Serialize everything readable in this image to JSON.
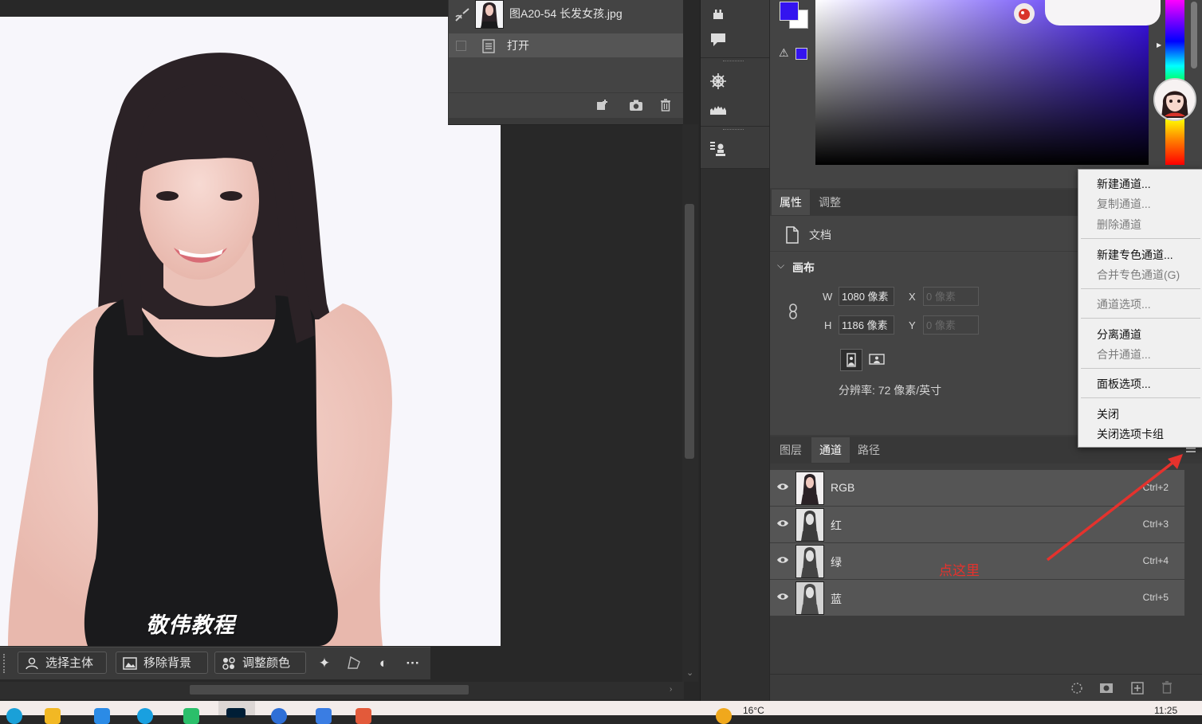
{
  "history": {
    "snapshot_label": "图A20-54 长发女孩.jpg",
    "step_label": "打开"
  },
  "context_bar": {
    "select_subject": "选择主体",
    "remove_background": "移除背景",
    "adjust_color": "调整颜色",
    "more": "···"
  },
  "canvas": {
    "watermark": "敬伟教程"
  },
  "properties": {
    "tabs": [
      "属性",
      "调整"
    ],
    "doc_label": "文档",
    "section_title": "画布",
    "w_label": "W",
    "h_label": "H",
    "x_label": "X",
    "y_label": "Y",
    "w_value": "1080 像素",
    "h_value": "1186 像素",
    "x_placeholder": "0 像素",
    "y_placeholder": "0 像素",
    "resolution": "分辨率: 72 像素/英寸"
  },
  "channels_panel": {
    "tabs": [
      "图层",
      "通道",
      "路径"
    ],
    "active_tab": "通道",
    "rows": [
      {
        "name": "RGB",
        "shortcut": "Ctrl+2"
      },
      {
        "name": "红",
        "shortcut": "Ctrl+3"
      },
      {
        "name": "绿",
        "shortcut": "Ctrl+4"
      },
      {
        "name": "蓝",
        "shortcut": "Ctrl+5"
      }
    ]
  },
  "menu": {
    "items": [
      {
        "label": "新建通道...",
        "enabled": true
      },
      {
        "label": "复制通道...",
        "enabled": false
      },
      {
        "label": "删除通道",
        "enabled": false
      },
      {
        "label": "新建专色通道...",
        "enabled": true
      },
      {
        "label": "合并专色通道(G)",
        "enabled": false
      },
      {
        "label": "通道选项...",
        "enabled": false
      },
      {
        "label": "分离通道",
        "enabled": true
      },
      {
        "label": "合并通道...",
        "enabled": false
      },
      {
        "label": "面板选项...",
        "enabled": true
      },
      {
        "label": "关闭",
        "enabled": true
      },
      {
        "label": "关闭选项卡组",
        "enabled": true
      }
    ]
  },
  "annotation": {
    "text": "点这里",
    "color": "#e5322d"
  },
  "colors": {
    "foreground": "#3414ef",
    "background": "#ffffff",
    "panel": "#444444",
    "accent_red": "#e5322d"
  },
  "system": {
    "temperature": "16°C",
    "time": "11:25"
  }
}
